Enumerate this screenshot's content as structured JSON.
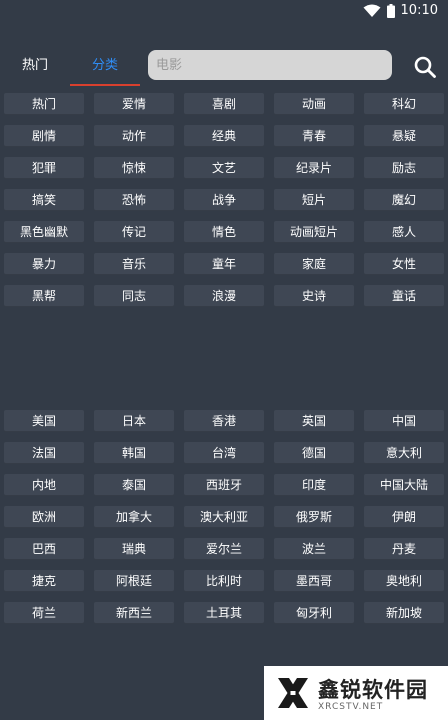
{
  "status_bar": {
    "time": "10:10"
  },
  "header": {
    "tabs": [
      {
        "label": "热门"
      },
      {
        "label": "分类"
      }
    ],
    "search": {
      "placeholder": "电影"
    }
  },
  "genres": [
    "热门",
    "爱情",
    "喜剧",
    "动画",
    "科幻",
    "剧情",
    "动作",
    "经典",
    "青春",
    "悬疑",
    "犯罪",
    "惊悚",
    "文艺",
    "纪录片",
    "励志",
    "搞笑",
    "恐怖",
    "战争",
    "短片",
    "魔幻",
    "黑色幽默",
    "传记",
    "情色",
    "动画短片",
    "感人",
    "暴力",
    "音乐",
    "童年",
    "家庭",
    "女性",
    "黑帮",
    "同志",
    "浪漫",
    "史诗",
    "童话"
  ],
  "regions": [
    "美国",
    "日本",
    "香港",
    "英国",
    "中国",
    "法国",
    "韩国",
    "台湾",
    "德国",
    "意大利",
    "内地",
    "泰国",
    "西班牙",
    "印度",
    "中国大陆",
    "欧洲",
    "加拿大",
    "澳大利亚",
    "俄罗斯",
    "伊朗",
    "巴西",
    "瑞典",
    "爱尔兰",
    "波兰",
    "丹麦",
    "捷克",
    "阿根廷",
    "比利时",
    "墨西哥",
    "奥地利",
    "荷兰",
    "新西兰",
    "土耳其",
    "匈牙利",
    "新加坡"
  ],
  "watermark": {
    "title": "鑫锐软件园",
    "subtitle": "XRCSTV.NET"
  },
  "colors": {
    "background": "#333b47",
    "chip": "#3f4754",
    "active_tab": "#2f8df5",
    "tab_underline": "#d9402e"
  }
}
